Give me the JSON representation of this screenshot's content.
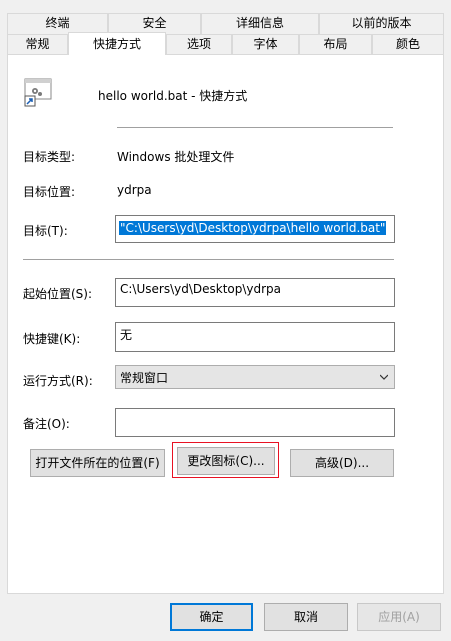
{
  "tabs_row1": [
    "终端",
    "安全",
    "详细信息",
    "以前的版本"
  ],
  "tabs_row2": [
    "常规",
    "快捷方式",
    "选项",
    "字体",
    "布局",
    "颜色"
  ],
  "shortcut_name": "hello world.bat - 快捷方式",
  "target_type": {
    "label": "目标类型:",
    "value": "Windows 批处理文件"
  },
  "target_location": {
    "label": "目标位置:",
    "value": "ydrpa"
  },
  "target": {
    "label": "目标(T):",
    "value": "\"C:\\Users\\yd\\Desktop\\ydrpa\\hello world.bat\""
  },
  "start_in": {
    "label": "起始位置(S):",
    "value": "C:\\Users\\yd\\Desktop\\ydrpa"
  },
  "shortcut_key": {
    "label": "快捷键(K):",
    "value": "无"
  },
  "run": {
    "label": "运行方式(R):",
    "value": "常规窗口"
  },
  "comment": {
    "label": "备注(O):",
    "value": ""
  },
  "buttons": {
    "open_location": "打开文件所在的位置(F)",
    "change_icon": "更改图标(C)...",
    "advanced": "高级(D)..."
  },
  "footer": {
    "ok": "确定",
    "cancel": "取消",
    "apply": "应用(A)"
  },
  "colors": {
    "accent": "#0078d7",
    "highlight_outline": "#e81123"
  }
}
